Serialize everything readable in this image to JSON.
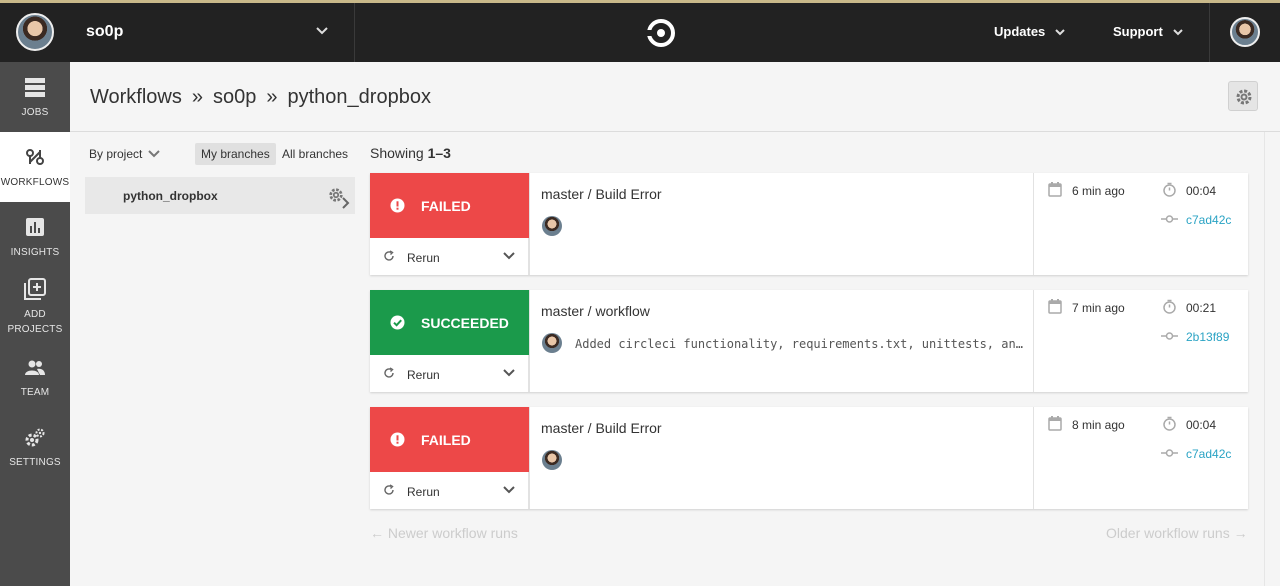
{
  "topbar": {
    "org_name": "so0p",
    "links": {
      "updates": "Updates",
      "support": "Support"
    }
  },
  "sidebar": {
    "items": [
      {
        "label": "JOBS",
        "icon": "jobs-icon"
      },
      {
        "label": "WORKFLOWS",
        "icon": "workflows-icon",
        "active": true
      },
      {
        "label": "INSIGHTS",
        "icon": "insights-icon"
      },
      {
        "label": "ADD PROJECTS",
        "icon": "add-projects-icon"
      },
      {
        "label": "TEAM",
        "icon": "team-icon"
      },
      {
        "label": "SETTINGS",
        "icon": "settings-icon"
      }
    ]
  },
  "breadcrumb": {
    "root": "Workflows",
    "sep": "»",
    "org": "so0p",
    "project": "python_dropbox"
  },
  "filters": {
    "by_project": "By project",
    "my_branches": "My branches",
    "all_branches": "All branches"
  },
  "project": {
    "name": "python_dropbox"
  },
  "showing": {
    "label": "Showing",
    "range": "1–3"
  },
  "runs": [
    {
      "status": "FAILED",
      "status_color": "#ed4848",
      "rerun": "Rerun",
      "title": "master / Build Error",
      "commit_message": "",
      "ago": "6 min ago",
      "duration": "00:04",
      "sha": "c7ad42c"
    },
    {
      "status": "SUCCEEDED",
      "status_color": "#1b9a4b",
      "rerun": "Rerun",
      "title": "master / workflow",
      "commit_message": "Added circleci functionality, requirements.txt, unittests, an…",
      "ago": "7 min ago",
      "duration": "00:21",
      "sha": "2b13f89"
    },
    {
      "status": "FAILED",
      "status_color": "#ed4848",
      "rerun": "Rerun",
      "title": "master / Build Error",
      "commit_message": "",
      "ago": "8 min ago",
      "duration": "00:04",
      "sha": "c7ad42c"
    }
  ],
  "pager": {
    "newer": "← Newer workflow runs",
    "older": "Older workflow runs →"
  },
  "colors": {
    "topbar": "#222222",
    "sidebar": "#4b4b4b",
    "failed": "#ed4848",
    "success": "#1b9a4b",
    "link": "#2aa3c4"
  }
}
